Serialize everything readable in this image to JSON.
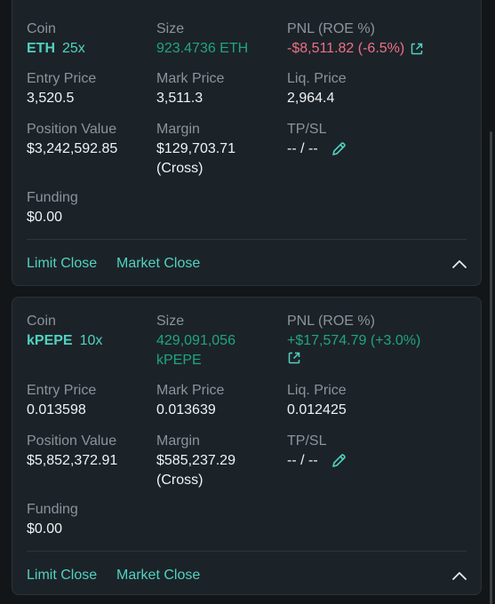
{
  "labels": {
    "coin": "Coin",
    "size": "Size",
    "pnl": "PNL (ROE %)",
    "entry": "Entry Price",
    "mark": "Mark Price",
    "liq": "Liq. Price",
    "position_value": "Position Value",
    "margin": "Margin",
    "tpsl": "TP/SL",
    "funding": "Funding",
    "limit_close": "Limit Close",
    "market_close": "Market Close"
  },
  "positions": [
    {
      "coin": "ETH",
      "leverage": "25x",
      "size": "923.4736 ETH",
      "size_line2": "",
      "pnl": "-$8,511.82 (-6.5%)",
      "pnl_sign": "negative",
      "entry": "3,520.5",
      "mark": "3,511.3",
      "liq": "2,964.4",
      "position_value": "$3,242,592.85",
      "margin": "$129,703.71",
      "margin_mode": "(Cross)",
      "tpsl": "-- / --",
      "funding": "$0.00"
    },
    {
      "coin": "kPEPE",
      "leverage": "10x",
      "size": "429,091,056",
      "size_line2": "kPEPE",
      "pnl": "+$17,574.79 (+3.0%)",
      "pnl_sign": "positive",
      "entry": "0.013598",
      "mark": "0.013639",
      "liq": "0.012425",
      "position_value": "$5,852,372.91",
      "margin": "$585,237.29",
      "margin_mode": "(Cross)",
      "tpsl": "-- / --",
      "funding": "$0.00"
    }
  ],
  "colors": {
    "accent": "#50d2c1",
    "positive": "#1fa67d",
    "negative": "#ed7088"
  },
  "icons": {
    "external": "external-link-icon",
    "edit": "pencil-icon",
    "collapse": "chevron-up-icon"
  }
}
